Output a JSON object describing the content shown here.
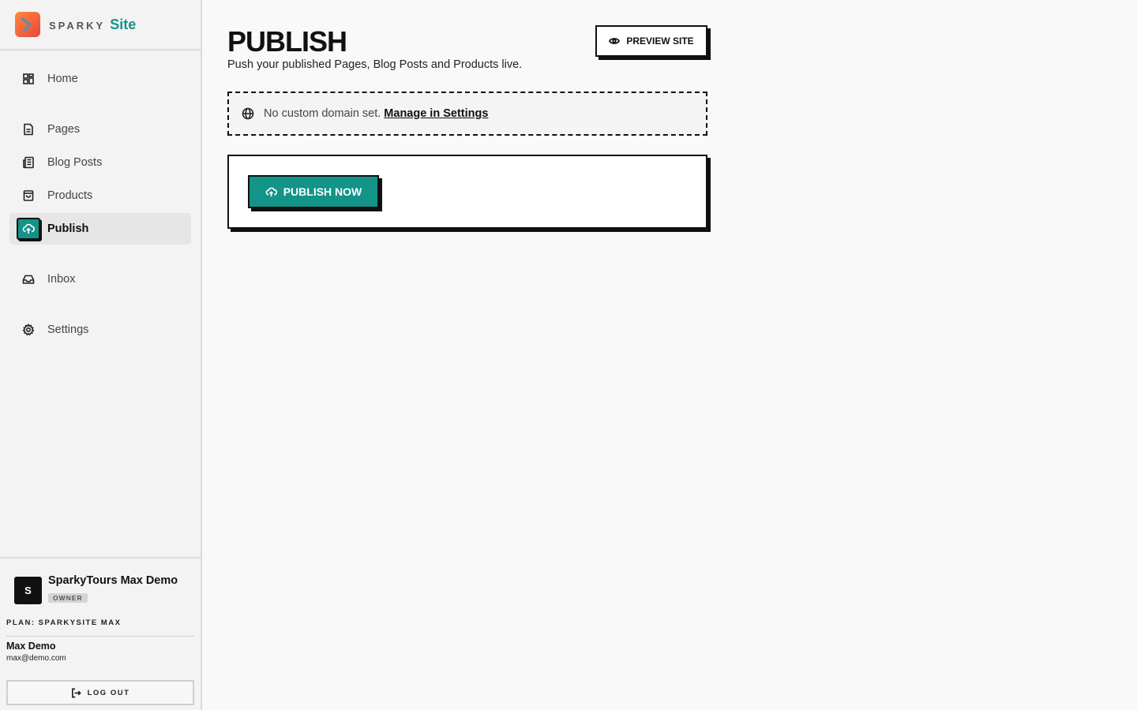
{
  "brand": {
    "word": "SPARKY",
    "site": "Site"
  },
  "sidebar": {
    "items": [
      {
        "label": "Home",
        "icon": "grid-icon"
      },
      {
        "label": "Pages",
        "icon": "file-icon"
      },
      {
        "label": "Blog Posts",
        "icon": "newspaper-icon"
      },
      {
        "label": "Products",
        "icon": "shopping-bag-icon"
      },
      {
        "label": "Publish",
        "icon": "cloud-upload-icon",
        "active": true
      },
      {
        "label": "Inbox",
        "icon": "inbox-icon"
      },
      {
        "label": "Settings",
        "icon": "gear-icon"
      }
    ]
  },
  "account": {
    "org_initial": "S",
    "org_name": "SparkyTours Max Demo",
    "role_badge": "OWNER",
    "plan": "PLAN: SPARKYSITE MAX",
    "user_name": "Max Demo",
    "user_email": "max@demo.com",
    "logout_label": "LOG OUT"
  },
  "main": {
    "title": "PUBLISH",
    "subtitle": "Push your published Pages, Blog Posts and Products live.",
    "preview_label": "PREVIEW SITE",
    "domain_text": "No custom domain set.",
    "domain_link": "Manage in Settings",
    "publish_label": "PUBLISH NOW"
  },
  "colors": {
    "accent": "#139488",
    "ink": "#111111",
    "sidebar_bg": "#f3f3f3"
  }
}
